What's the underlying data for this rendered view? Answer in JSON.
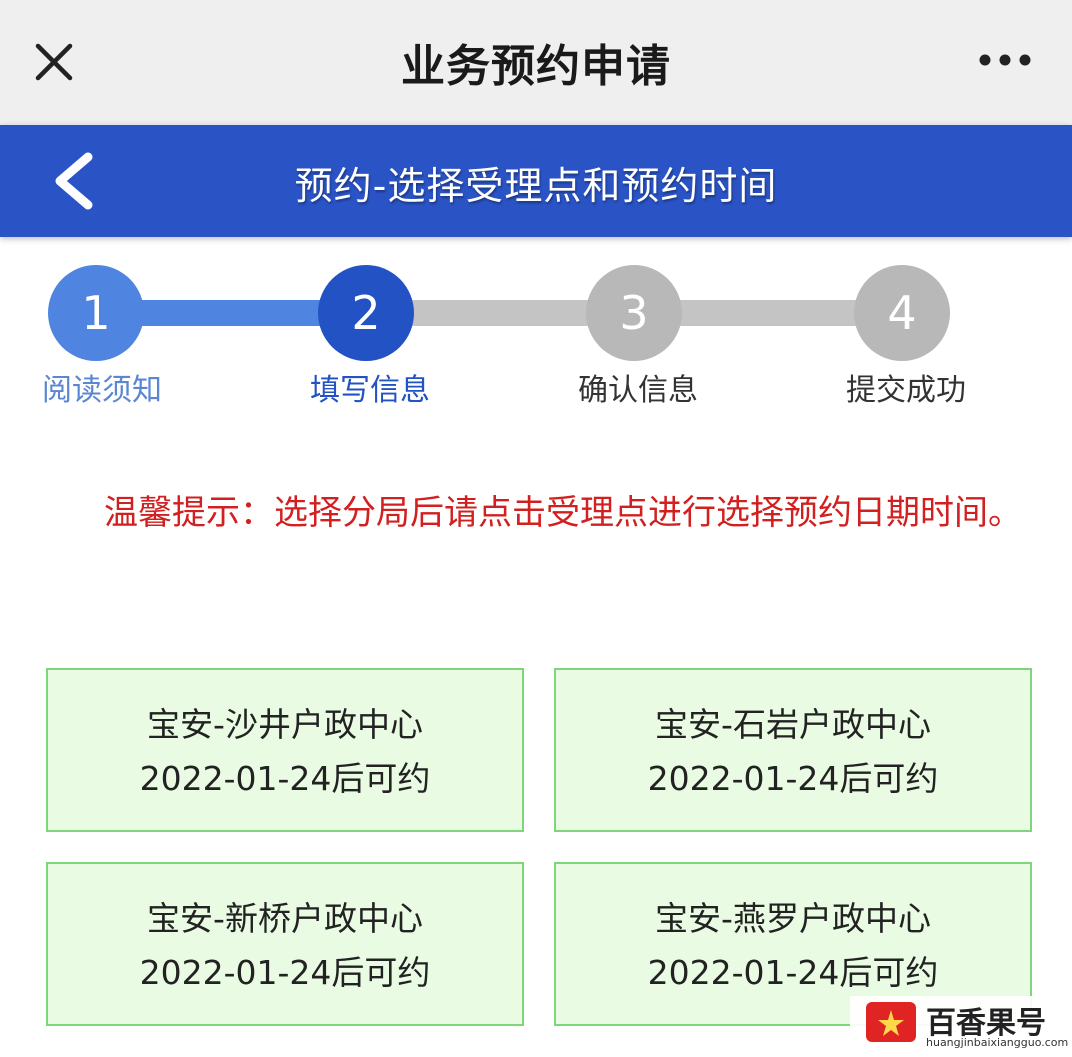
{
  "topbar": {
    "title": "业务预约申请"
  },
  "header": {
    "title": "预约-选择受理点和预约时间"
  },
  "steps": [
    {
      "number": "1",
      "label": "阅读须知",
      "state": "done"
    },
    {
      "number": "2",
      "label": "填写信息",
      "state": "current"
    },
    {
      "number": "3",
      "label": "确认信息",
      "state": "pending"
    },
    {
      "number": "4",
      "label": "提交成功",
      "state": "pending"
    }
  ],
  "tip": {
    "text": "温馨提示：选择分局后请点击受理点进行选择预约日期时间。"
  },
  "centers": [
    {
      "name": "宝安-沙井户政中心",
      "availability": "2022-01-24后可约"
    },
    {
      "name": "宝安-石岩户政中心",
      "availability": "2022-01-24后可约"
    },
    {
      "name": "宝安-新桥户政中心",
      "availability": "2022-01-24后可约"
    },
    {
      "name": "宝安-燕罗户政中心",
      "availability": "2022-01-24后可约"
    }
  ],
  "watermark": {
    "brand": "百香果号",
    "url": "huangjinbaixiangguo.com"
  },
  "colors": {
    "header_blue": "#2a54c6",
    "step_done": "#4f84e0",
    "step_current": "#2352c4",
    "step_pending": "#b8b8b8",
    "tip_red": "#d21f1f",
    "card_bg": "#e9fbe3",
    "card_border": "#7ed57a"
  },
  "icons": {
    "close": "close-icon",
    "more": "more-icon",
    "back": "back-chevron-icon"
  }
}
